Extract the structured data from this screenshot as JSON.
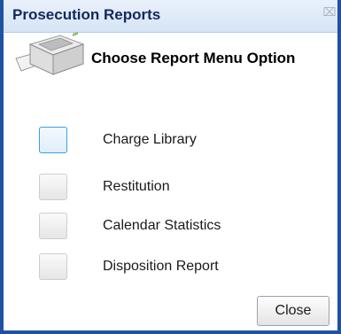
{
  "window": {
    "title": "Prosecution Reports",
    "close_glyph": "⌧"
  },
  "dialog": {
    "heading": "Choose Report Menu Option",
    "icon": "printer-icon"
  },
  "options": [
    {
      "label": "Charge Library",
      "focused": true
    },
    {
      "label": "Restitution",
      "focused": false
    },
    {
      "label": "Calendar Statistics",
      "focused": false
    },
    {
      "label": "Disposition Report",
      "focused": false
    }
  ],
  "buttons": {
    "close_label": "Close"
  },
  "colors": {
    "border": "#1f52a3",
    "title_text": "#14285a",
    "focus": "#39a0e6"
  }
}
